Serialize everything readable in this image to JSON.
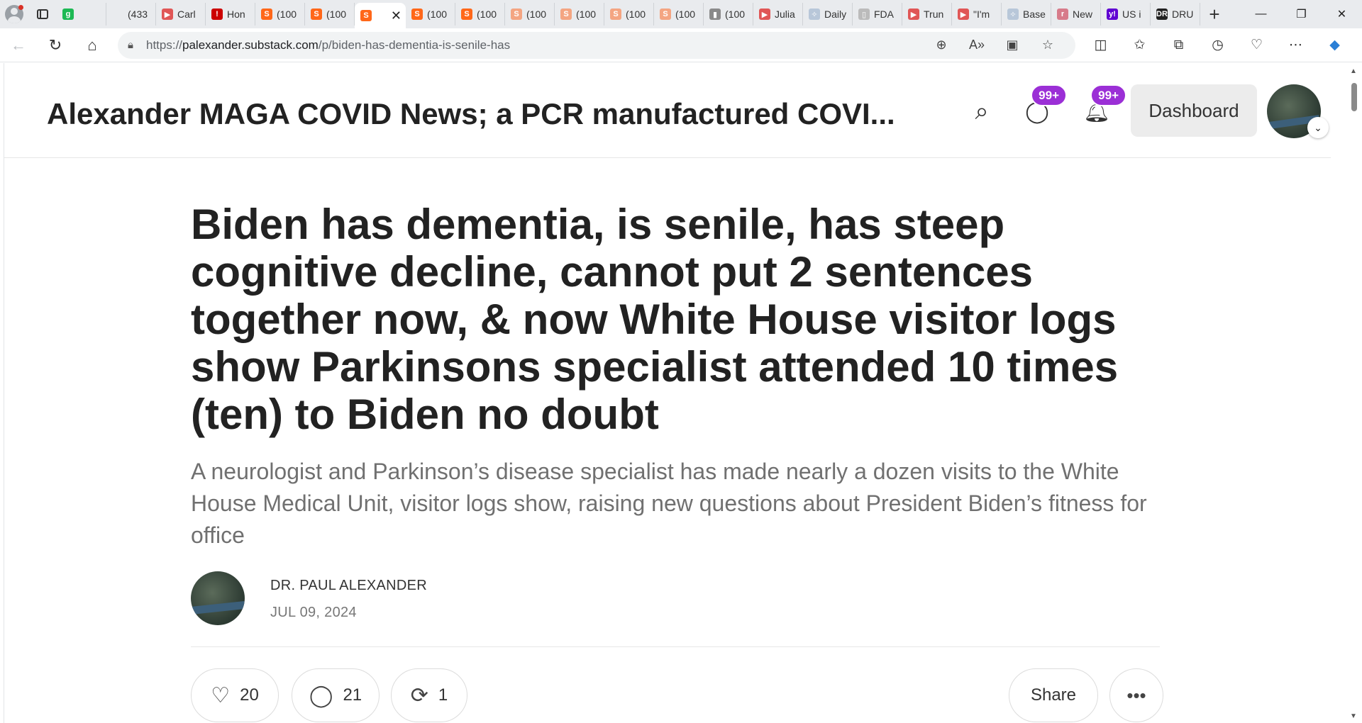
{
  "browser": {
    "tabs": [
      {
        "label": "",
        "fav": "g",
        "color": "#1db954"
      },
      {
        "label": "(433",
        "fav": "",
        "color": "#e9ebee"
      },
      {
        "label": "Carl",
        "fav": "▶",
        "color": "#e05656"
      },
      {
        "label": "Hon",
        "fav": "!",
        "color": "#c00"
      },
      {
        "label": "(100",
        "fav": "S",
        "color": "#ff6719"
      },
      {
        "label": "(100",
        "fav": "S",
        "color": "#ff6719"
      },
      {
        "label": "",
        "fav": "S",
        "color": "#ff6719",
        "active": true
      },
      {
        "label": "(100",
        "fav": "S",
        "color": "#ff6719"
      },
      {
        "label": "(100",
        "fav": "S",
        "color": "#ff6719"
      },
      {
        "label": "(100",
        "fav": "S",
        "color": "#f4a582"
      },
      {
        "label": "(100",
        "fav": "S",
        "color": "#f4a582"
      },
      {
        "label": "(100",
        "fav": "S",
        "color": "#f4a582"
      },
      {
        "label": "(100",
        "fav": "S",
        "color": "#f4a582"
      },
      {
        "label": "(100",
        "fav": "▮",
        "color": "#8a8a8a"
      },
      {
        "label": "Julia",
        "fav": "▶",
        "color": "#e05656"
      },
      {
        "label": "Daily",
        "fav": "✧",
        "color": "#b8c7d9"
      },
      {
        "label": "FDA",
        "fav": "▯",
        "color": "#bbb"
      },
      {
        "label": "Trun",
        "fav": "▶",
        "color": "#e05656"
      },
      {
        "label": "\"I'm",
        "fav": "▶",
        "color": "#e05656"
      },
      {
        "label": "Base",
        "fav": "✧",
        "color": "#b8c7d9"
      },
      {
        "label": "New",
        "fav": "r",
        "color": "#d77b8a"
      },
      {
        "label": "US i",
        "fav": "y!",
        "color": "#6001d2"
      },
      {
        "label": "DRU",
        "fav": "DR",
        "color": "#222"
      }
    ],
    "url_prefix": "https://",
    "url_host": "palexander.substack.com",
    "url_path": "/p/biden-has-dementia-is-senile-has"
  },
  "site": {
    "title": "Alexander MAGA COVID News; a PCR manufactured COVI...",
    "chat_badge": "99+",
    "notif_badge": "99+",
    "dashboard_label": "Dashboard"
  },
  "post": {
    "headline": "Biden has dementia, is senile, has steep cognitive decline, cannot put 2 sentences together now, & now White House visitor logs show Parkinsons specialist attended 10 times (ten) to Biden no doubt",
    "subtitle": "A neurologist and Parkinson’s disease specialist has made nearly a dozen visits to the White House Medical Unit, visitor logs show, raising new questions about President Biden’s fitness for office",
    "author": "DR. PAUL ALEXANDER",
    "date": "JUL 09, 2024",
    "likes": "20",
    "comments": "21",
    "restacks": "1",
    "share_label": "Share"
  }
}
